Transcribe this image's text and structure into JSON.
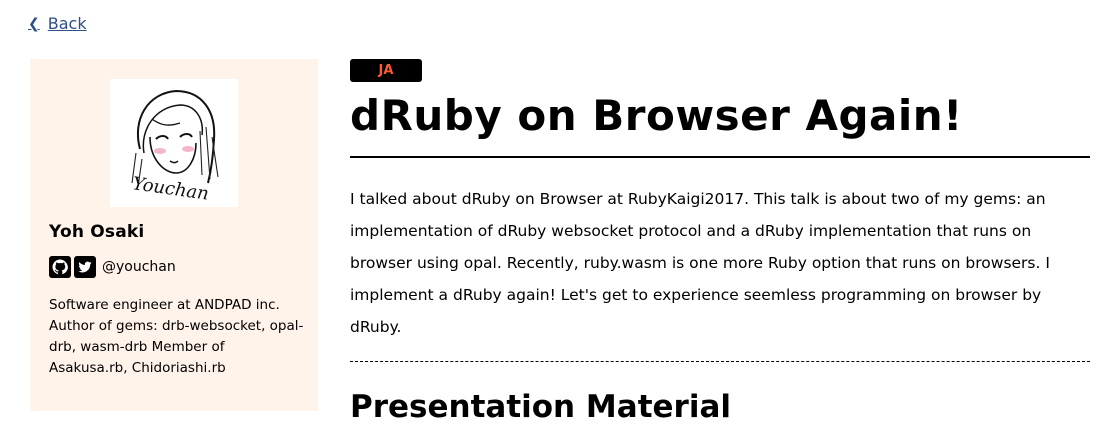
{
  "nav": {
    "back_label": "Back"
  },
  "speaker": {
    "avatar_signature": "Youchan",
    "name": "Yoh Osaki",
    "handle": "@youchan",
    "social_icons": [
      "github-icon",
      "twitter-icon"
    ],
    "bio": "Software engineer at ANDPAD inc. Author of gems: drb-websocket, opal-drb, wasm-drb Member of Asakusa.rb, Chidoriashi.rb"
  },
  "talk": {
    "language": "JA",
    "title": "dRuby on Browser Again!",
    "abstract": "I talked about dRuby on Browser at RubyKaigi2017. This talk is about two of my gems: an implementation of dRuby websocket protocol and a dRuby implementation that runs on browser using opal. Recently, ruby.wasm is one more Ruby option that runs on browsers. I implement a dRuby again! Let's get to experience seemless programming on browser by dRuby.",
    "section_heading": "Presentation Material"
  },
  "colors": {
    "link": "#2c4f86",
    "sidebar_bg": "#fff3ea",
    "badge_bg": "#000000",
    "badge_text": "#ff5a2e"
  }
}
